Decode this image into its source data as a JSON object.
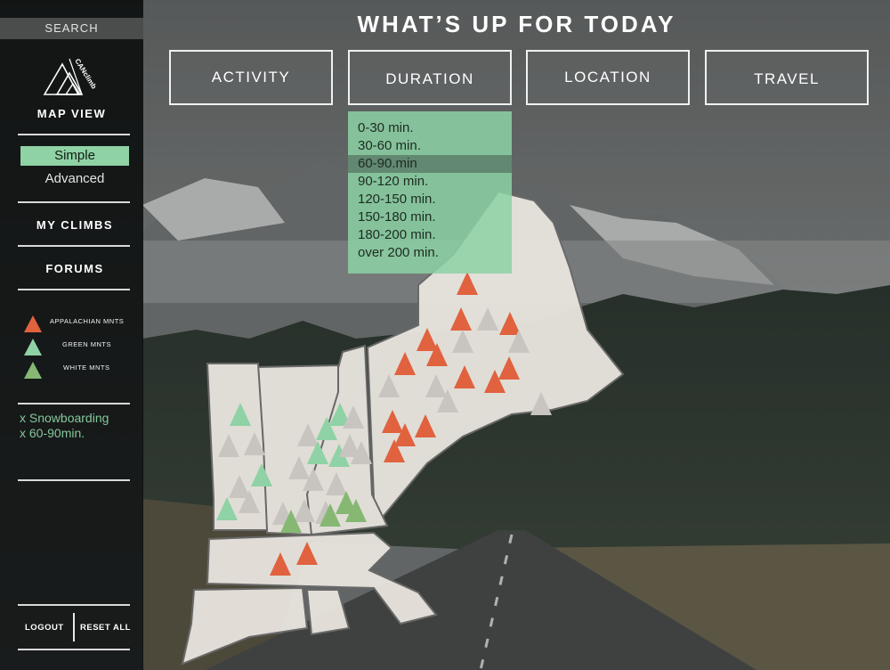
{
  "header": {
    "title": "WHAT’S UP FOR TODAY"
  },
  "tabs": [
    "ACTIVITY",
    "DURATION",
    "LOCATION",
    "TRAVEL"
  ],
  "sidebar": {
    "search_label": "SEARCH",
    "logo_text": "CANclimb",
    "map_view_label": "MAP VIEW",
    "view_options": [
      "Simple",
      "Advanced"
    ],
    "selected_view": "Simple",
    "nav": [
      "MY CLIMBS",
      "FORUMS"
    ],
    "legend": [
      {
        "label": "APPALACHIAN MNTS",
        "color": "#e0623f"
      },
      {
        "label": "GREEN MNTS",
        "color": "#8fd2a5"
      },
      {
        "label": "WHITE MNTS",
        "color": "#86b873"
      }
    ],
    "active_filters": [
      "x Snowboarding",
      "x 60-90min."
    ],
    "logout_label": "LOGOUT",
    "reset_label": "RESET ALL"
  },
  "duration_dropdown": {
    "options": [
      "0-30 min.",
      "30-60 min.",
      "60-90.min",
      "90-120 min.",
      "120-150 min.",
      "150-180 min.",
      "180-200 min.",
      "over 200 min."
    ],
    "selected": "60-90.min"
  },
  "colors": {
    "accent_green": "#8fd2a5",
    "appalachian_red": "#e0623f",
    "white_mnts_green": "#86b873",
    "inactive_peak": "#c8c4c0",
    "map_land": "#e8e4dd"
  }
}
